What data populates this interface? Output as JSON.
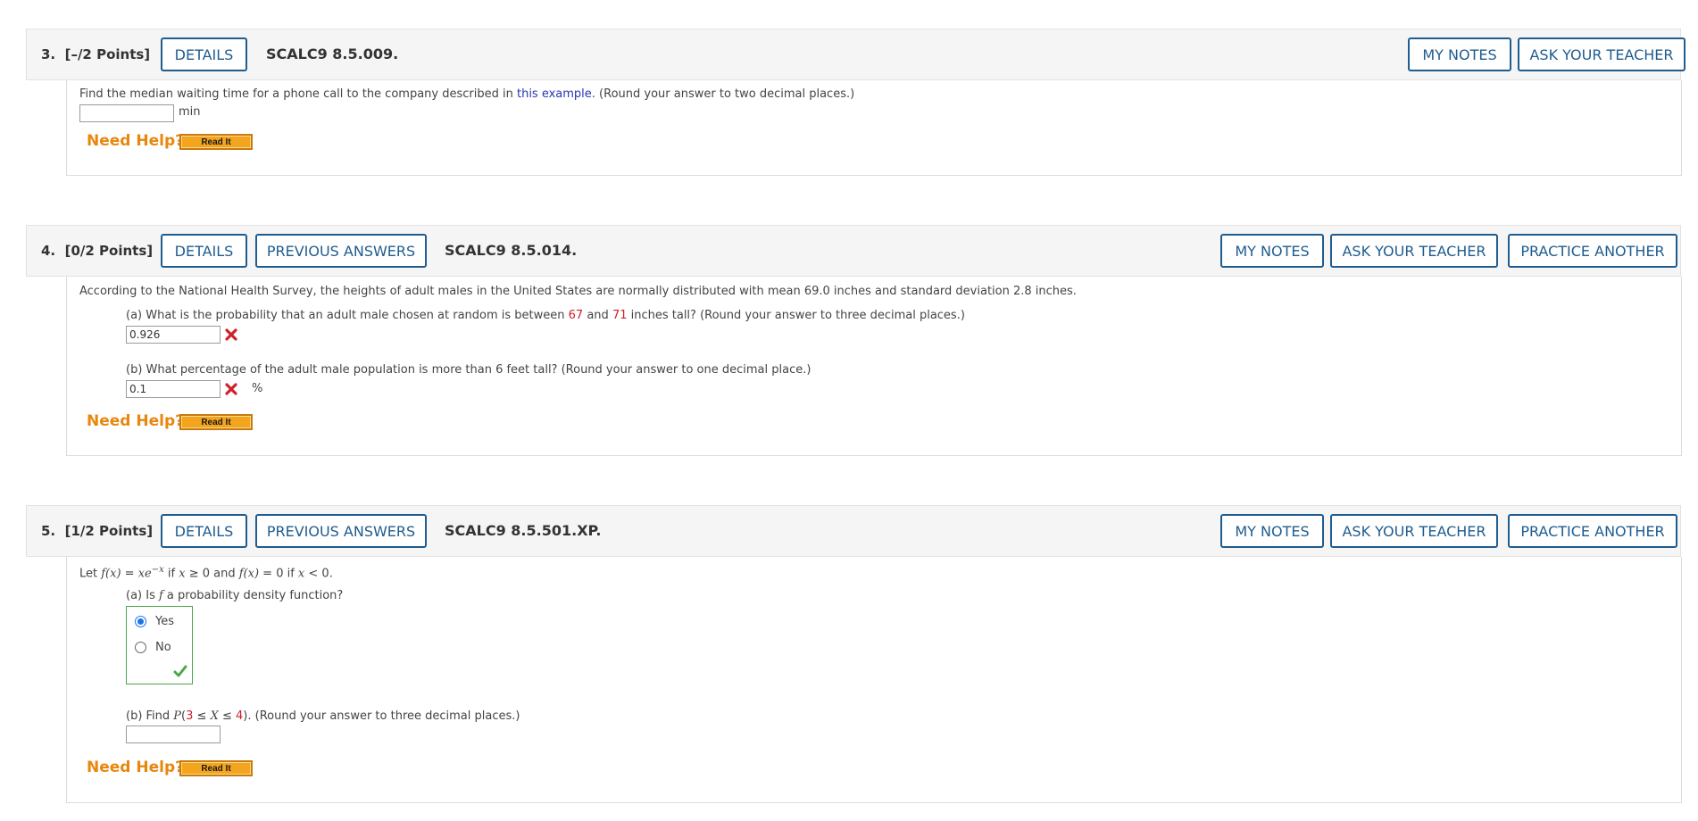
{
  "colors": {
    "accent": "#1f5c8f",
    "need_help": "#e8870e",
    "incorrect": "#d0202a",
    "correct": "#4aa84a",
    "link": "#2a36b0"
  },
  "common": {
    "details": "DETAILS",
    "previous_answers": "PREVIOUS ANSWERS",
    "my_notes": "MY NOTES",
    "ask_teacher": "ASK YOUR TEACHER",
    "practice_another": "PRACTICE ANOTHER",
    "need_help": "Need Help?",
    "read_it": "Read It"
  },
  "q3": {
    "number": "3.",
    "points": "[–/2 Points]",
    "code": "SCALC9 8.5.009.",
    "prompt_before": "Find the median waiting time for a phone call to the company described in ",
    "prompt_link": "this example",
    "prompt_after": ". (Round your answer to two decimal places.)",
    "answer_value": "",
    "unit": "min"
  },
  "q4": {
    "number": "4.",
    "points": "[0/2 Points]",
    "code": "SCALC9 8.5.014.",
    "intro": "According to the National Health Survey, the heights of adult males in the United States are normally distributed with mean 69.0 inches and standard deviation 2.8 inches.",
    "a_before": "(a) What is the probability that an adult male chosen at random is between ",
    "a_val1": "67",
    "a_mid": " and ",
    "a_val2": "71",
    "a_after": " inches tall? (Round your answer to three decimal places.)",
    "a_answer": "0.926",
    "b_prompt": "(b) What percentage of the adult male population is more than 6 feet tall? (Round your answer to one decimal place.)",
    "b_answer": "0.1",
    "b_unit": "%"
  },
  "q5": {
    "number": "5.",
    "points": "[1/2 Points]",
    "code": "SCALC9 8.5.501.XP.",
    "let": "Let ",
    "fx1": "f(x)",
    "eq1": " = ",
    "xe": "xe",
    "exp": "−x",
    "if1": " if ",
    "x1": "x",
    "ge0": " ≥ 0 and ",
    "fx2": "f(x)",
    "eq0": " = 0 if ",
    "x2": "x",
    "lt0": " < 0.",
    "a_before": "(a) Is ",
    "a_f": "f",
    "a_after": " a probability density function?",
    "opt_yes": "Yes",
    "opt_no": "No",
    "b_before": "(b) Find ",
    "b_P": "P",
    "b_open": "(",
    "b_3": "3",
    "b_le1": " ≤ ",
    "b_X": "X",
    "b_le2": " ≤ ",
    "b_4": "4",
    "b_close": ")",
    "b_after": ". (Round your answer to three decimal places.)",
    "b_answer": ""
  }
}
